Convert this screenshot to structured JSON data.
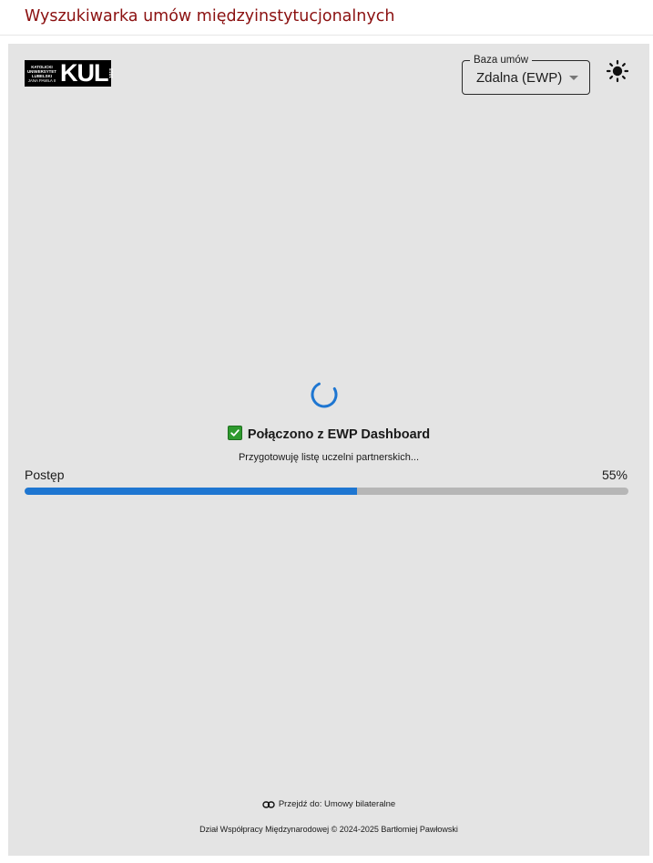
{
  "header": {
    "title": "Wyszukiwarka umów międzyinstytucjonalnych",
    "title_color": "#8b1010"
  },
  "logo": {
    "lines": [
      "KATOLICKI",
      "UNIWERSYTET",
      "LUBELSKI",
      "JANA PAWŁA II"
    ],
    "mark": "KUL",
    "side_text": "1918"
  },
  "database_select": {
    "legend": "Baza umów",
    "value": "Zdalna (EWP)"
  },
  "theme_toggle": {
    "icon": "sun-icon"
  },
  "loading": {
    "status": "Połączono z EWP Dashboard",
    "status_icon": "check-icon",
    "substatus": "Przygotowuję listę uczelni partnerskich...",
    "spinner_color": "#1e76d1"
  },
  "progress": {
    "label": "Postęp",
    "value_text": "55%",
    "value": 55,
    "fill_color": "#1e76d1",
    "track_color": "#b6b6b6"
  },
  "footer": {
    "link_text": "Przejdź do: Umowy bilateralne",
    "link_icon": "link-icon",
    "credit": "Dział Współpracy Międzynarodowej © 2024-2025 Bartłomiej Pawłowski"
  }
}
